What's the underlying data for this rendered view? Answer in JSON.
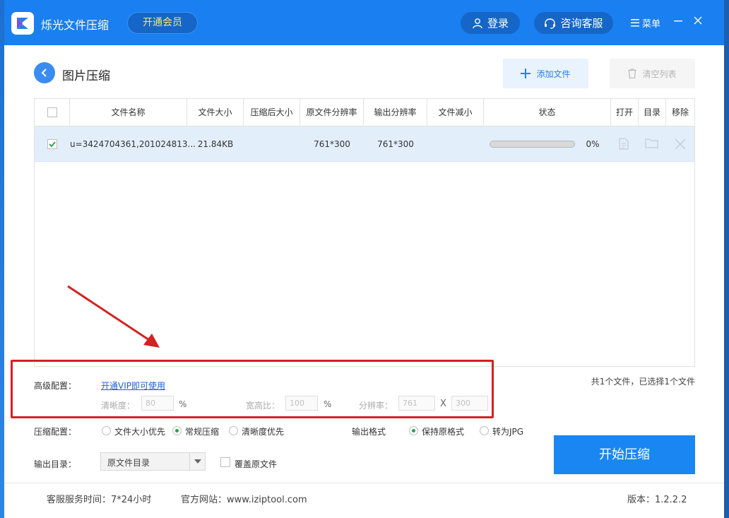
{
  "app": {
    "name": "烁光文件压缩",
    "vip_label": "开通会员",
    "login_label": "登录",
    "service_label": "咨询客服",
    "menu_label": "菜单"
  },
  "header": {
    "title": "图片压缩",
    "add_file_label": "添加文件",
    "clear_list_label": "清空列表"
  },
  "table": {
    "columns": [
      "文件名称",
      "文件大小",
      "压缩后大小",
      "原文件分辨率",
      "输出分辨率",
      "文件减小",
      "状态",
      "打开",
      "目录",
      "移除"
    ],
    "rows": [
      {
        "checked": true,
        "name": "u=3424704361,201024813...",
        "size": "21.84KB",
        "compressed_size": "",
        "orig_resolution": "761*300",
        "out_resolution": "761*300",
        "reduced": "",
        "progress_percent": 0,
        "progress_text": "0%"
      }
    ]
  },
  "summary": "共1个文件，已选择1个文件",
  "advanced": {
    "label": "高级配置：",
    "vip_link": "开通VIP即可使用",
    "clarity_label": "清晰度：",
    "clarity_value": "80",
    "clarity_unit": "%",
    "aspect_label": "宽高比：",
    "aspect_value": "100",
    "aspect_unit": "%",
    "resolution_label": "分辨率：",
    "res_w": "761",
    "res_x": "X",
    "res_h": "300"
  },
  "compress_config": {
    "label": "压缩配置：",
    "options": [
      "文件大小优先",
      "常规压缩",
      "清晰度优先"
    ],
    "selected": 1
  },
  "output_format": {
    "label": "输出格式",
    "options": [
      "保持原格式",
      "转为JPG"
    ],
    "selected": 0
  },
  "output_dir": {
    "label": "输出目录：",
    "value": "原文件目录",
    "overwrite_label": "覆盖原文件"
  },
  "start_label": "开始压缩",
  "footer": {
    "service_time": "客服服务时间：7*24小时",
    "website": "官方网站：www.iziptool.com",
    "version": "版本：1.2.2.2"
  },
  "colors": {
    "titlebar": "#1a7ff0",
    "accent": "#1a86f2",
    "annotation_red": "#d42121"
  }
}
